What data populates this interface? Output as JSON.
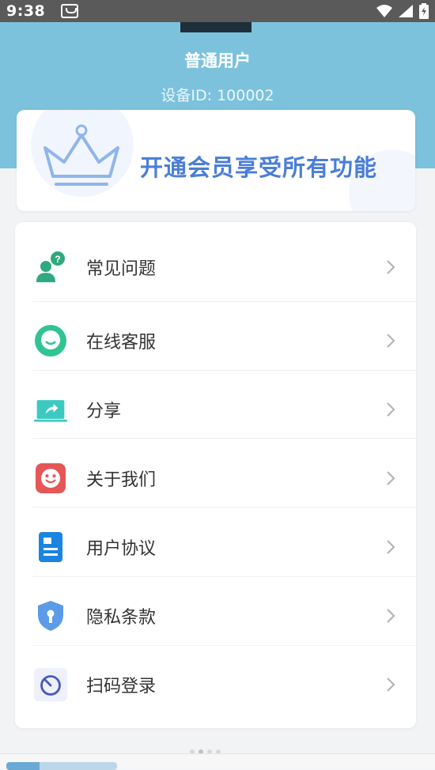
{
  "status_bar": {
    "time": "9:38"
  },
  "profile": {
    "username": "普通用户",
    "device_id": "设备ID: 100002"
  },
  "vip_card": {
    "text": "开通会员享受所有功能",
    "icon": "crown-icon"
  },
  "menu": {
    "items": [
      {
        "label": "常见问题",
        "icon": "faq-icon",
        "color": "#2fa97e"
      },
      {
        "label": "在线客服",
        "icon": "chat-icon",
        "color": "#30c493"
      },
      {
        "label": "分享",
        "icon": "share-icon",
        "color": "#3cc9c0"
      },
      {
        "label": "关于我们",
        "icon": "smile-icon",
        "color": "#e55656"
      },
      {
        "label": "用户协议",
        "icon": "document-icon",
        "color": "#1a84e0"
      },
      {
        "label": "隐私条款",
        "icon": "shield-icon",
        "color": "#5b9be8"
      },
      {
        "label": "扫码登录",
        "icon": "scan-icon",
        "color": "#4a5bb8"
      }
    ]
  },
  "colors": {
    "header": "#7dc2dc",
    "accent": "#4a7ed8"
  }
}
